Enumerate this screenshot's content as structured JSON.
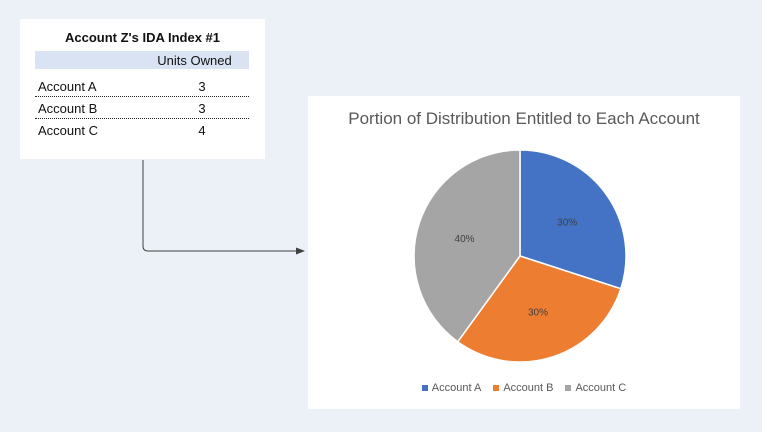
{
  "table": {
    "title": "Account Z's IDA Index #1",
    "column_header": "Units Owned",
    "rows": [
      {
        "account": "Account A",
        "units": "3"
      },
      {
        "account": "Account B",
        "units": "3"
      },
      {
        "account": "Account C",
        "units": "4"
      }
    ]
  },
  "chart_data": {
    "type": "pie",
    "title": "Portion of Distribution Entitled to Each Account",
    "categories": [
      "Account A",
      "Account B",
      "Account C"
    ],
    "values": [
      30,
      30,
      40
    ],
    "labels": [
      "30%",
      "30%",
      "40%"
    ],
    "colors": [
      "#4472c4",
      "#ed7d31",
      "#a5a5a5"
    ],
    "legend_position": "bottom"
  }
}
